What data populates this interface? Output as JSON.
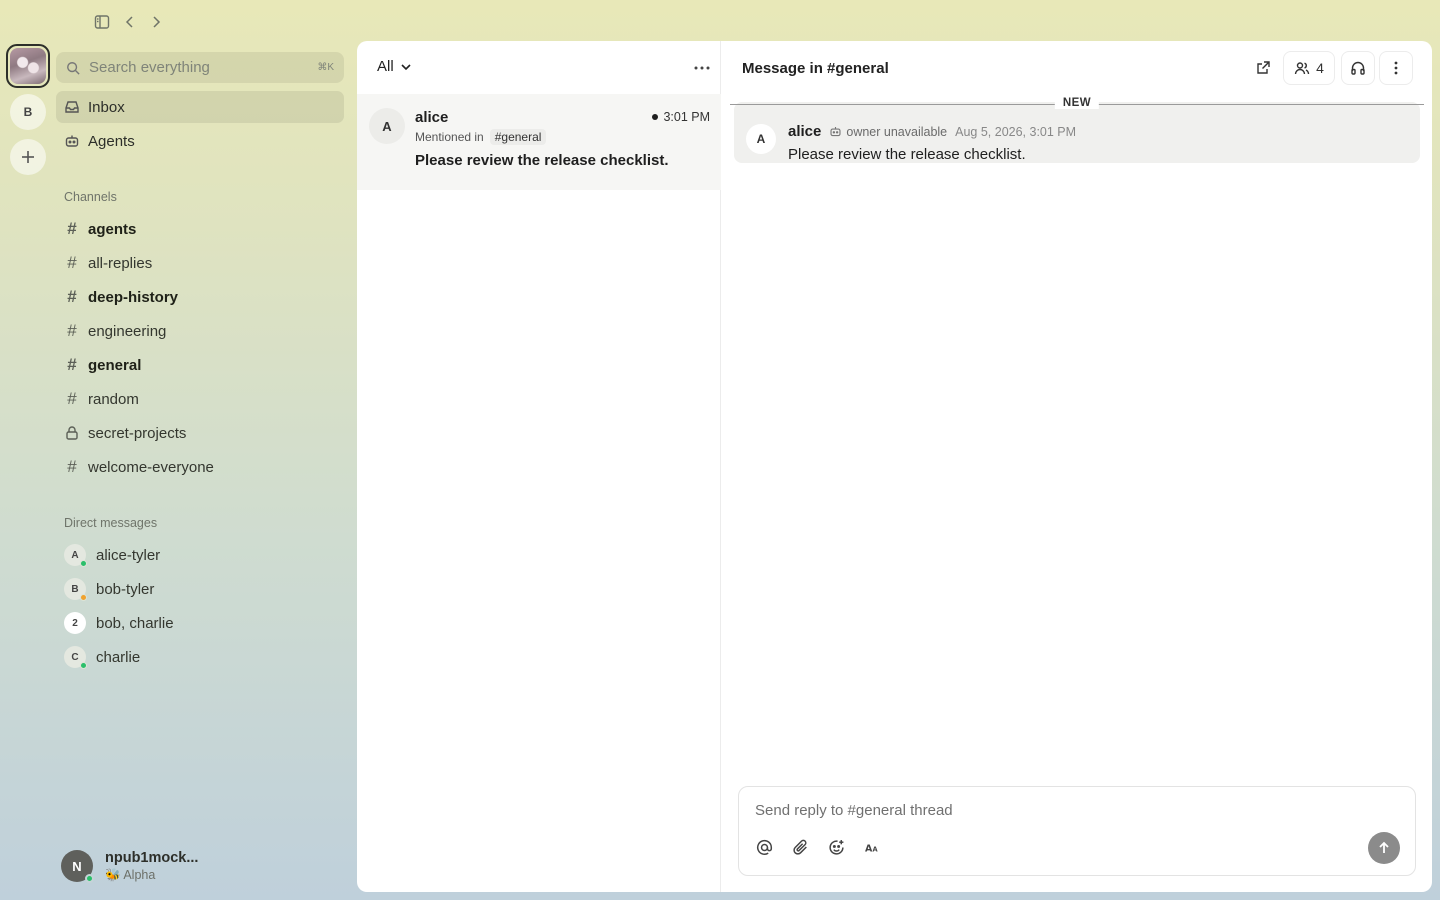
{
  "search": {
    "placeholder": "Search everything",
    "shortcut": "⌘K"
  },
  "workspaces": [
    {
      "label": ""
    },
    {
      "label": "B"
    }
  ],
  "nav": {
    "inbox": "Inbox",
    "agents": "Agents"
  },
  "channels": {
    "heading": "Channels",
    "items": [
      {
        "name": "agents",
        "unread": true,
        "private": false
      },
      {
        "name": "all-replies",
        "unread": false,
        "private": false
      },
      {
        "name": "deep-history",
        "unread": true,
        "private": false
      },
      {
        "name": "engineering",
        "unread": false,
        "private": false
      },
      {
        "name": "general",
        "unread": true,
        "private": false
      },
      {
        "name": "random",
        "unread": false,
        "private": false
      },
      {
        "name": "secret-projects",
        "unread": false,
        "private": true
      },
      {
        "name": "welcome-everyone",
        "unread": false,
        "private": false
      }
    ]
  },
  "direct_messages": {
    "heading": "Direct messages",
    "items": [
      {
        "name": "alice-tyler",
        "initial": "A",
        "status_color": "#2bbf6b"
      },
      {
        "name": "bob-tyler",
        "initial": "B",
        "status_color": "#f0a22e"
      },
      {
        "name": "bob, charlie",
        "initial": "2",
        "status_color": ""
      },
      {
        "name": "charlie",
        "initial": "C",
        "status_color": "#2bbf6b"
      }
    ]
  },
  "profile": {
    "initial": "N",
    "name": "npub1mock...",
    "status": "🐝 Alpha"
  },
  "inbox": {
    "filter": "All",
    "items": [
      {
        "initial": "A",
        "author": "alice",
        "time": "3:01 PM",
        "mention_prefix": "Mentioned in",
        "channel": "#general",
        "text": "Please review the release checklist."
      }
    ]
  },
  "thread": {
    "title": "Message in #general",
    "member_count": "4",
    "divider_label": "NEW",
    "message": {
      "initial": "A",
      "author": "alice",
      "owner_status": "owner unavailable",
      "timestamp": "Aug 5, 2026, 3:01 PM",
      "text": "Please review the release checklist."
    },
    "composer": {
      "placeholder": "Send reply to #general thread"
    }
  }
}
